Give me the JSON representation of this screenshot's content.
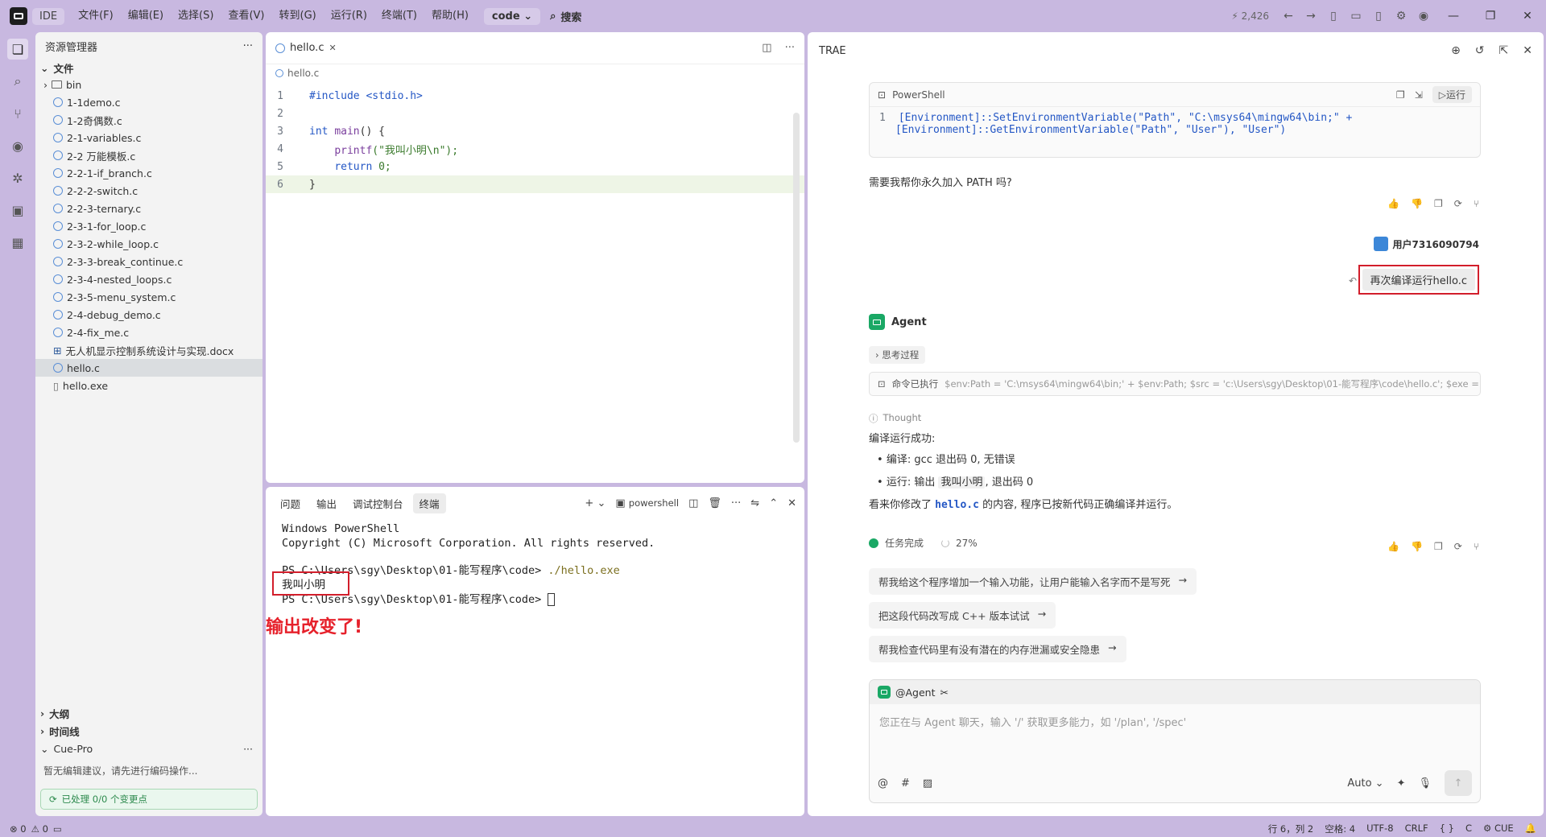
{
  "titlebar": {
    "ide_label": "IDE",
    "menu": [
      "文件(F)",
      "编辑(E)",
      "选择(S)",
      "查看(V)",
      "转到(G)",
      "运行(R)",
      "终端(T)",
      "帮助(H)"
    ],
    "project_dropdown": "code",
    "search_label": "搜索",
    "count": "2,426"
  },
  "explorer": {
    "title": "资源管理器",
    "folder_section": "文件",
    "items": [
      {
        "name": "bin",
        "type": "folder"
      },
      {
        "name": "1-1demo.c",
        "type": "c"
      },
      {
        "name": "1-2奇偶数.c",
        "type": "c"
      },
      {
        "name": "2-1-variables.c",
        "type": "c"
      },
      {
        "name": "2-2 万能模板.c",
        "type": "c"
      },
      {
        "name": "2-2-1-if_branch.c",
        "type": "c"
      },
      {
        "name": "2-2-2-switch.c",
        "type": "c"
      },
      {
        "name": "2-2-3-ternary.c",
        "type": "c"
      },
      {
        "name": "2-3-1-for_loop.c",
        "type": "c"
      },
      {
        "name": "2-3-2-while_loop.c",
        "type": "c"
      },
      {
        "name": "2-3-3-break_continue.c",
        "type": "c"
      },
      {
        "name": "2-3-4-nested_loops.c",
        "type": "c"
      },
      {
        "name": "2-3-5-menu_system.c",
        "type": "c"
      },
      {
        "name": "2-4-debug_demo.c",
        "type": "c"
      },
      {
        "name": "2-4-fix_me.c",
        "type": "c"
      },
      {
        "name": "无人机显示控制系统设计与实现.docx",
        "type": "doc"
      },
      {
        "name": "hello.c",
        "type": "c"
      },
      {
        "name": "hello.exe",
        "type": "exe"
      }
    ],
    "outline": "大纲",
    "timeline": "时间线",
    "cue_pro": "Cue-Pro",
    "cue_text": "暂无编辑建议，请先进行编码操作...",
    "cue_status": "已处理 0/0 个变更点"
  },
  "editor": {
    "tab": "hello.c",
    "breadcrumb": "hello.c",
    "lines": [
      {
        "n": "1",
        "parts": [
          {
            "t": "#include <stdio.h>",
            "c": "kw"
          }
        ]
      },
      {
        "n": "2",
        "parts": []
      },
      {
        "n": "3",
        "parts": [
          {
            "t": "int ",
            "c": "kw"
          },
          {
            "t": "main",
            "c": "fn"
          },
          {
            "t": "() {",
            "c": ""
          }
        ]
      },
      {
        "n": "4",
        "parts": [
          {
            "t": "    ",
            "c": ""
          },
          {
            "t": "printf",
            "c": "fn"
          },
          {
            "t": "(\"我叫小明\\n\");",
            "c": "str"
          }
        ]
      },
      {
        "n": "5",
        "parts": [
          {
            "t": "    ",
            "c": ""
          },
          {
            "t": "return ",
            "c": "kw"
          },
          {
            "t": "0;",
            "c": "str"
          }
        ]
      },
      {
        "n": "6",
        "parts": [
          {
            "t": "}",
            "c": ""
          }
        ]
      }
    ]
  },
  "terminal": {
    "tabs": [
      "问题",
      "输出",
      "调试控制台",
      "终端"
    ],
    "shell": "powershell",
    "lines": [
      {
        "text": "Windows PowerShell",
        "cmd": ""
      },
      {
        "text": "Copyright (C) Microsoft Corporation. All rights reserved.",
        "cmd": ""
      },
      {
        "text": "",
        "cmd": ""
      },
      {
        "text": "PS C:\\Users\\sgy\\Desktop\\01-能写程序\\code> ",
        "cmd": "./hello.exe"
      },
      {
        "text": "我叫小明",
        "cmd": ""
      },
      {
        "text": "PS C:\\Users\\sgy\\Desktop\\01-能写程序\\code> ",
        "cmd": ""
      }
    ],
    "annotation": "输出改变了!"
  },
  "agent": {
    "title": "TRAE",
    "ps_label": "PowerShell",
    "ps_run": "运行",
    "ps_line1": "[Environment]::SetEnvironmentVariable(\"Path\", \"C:\\msys64\\mingw64\\bin;\" +",
    "ps_line2": "[Environment]::GetEnvironmentVariable(\"Path\", \"User\"), \"User\")",
    "question": "需要我帮你永久加入 PATH 吗?",
    "user_name": "用户7316090794",
    "user_msg": "再次编译运行hello.c",
    "agent_name": "Agent",
    "thinking": "思考过程",
    "cmd_label": "命令已执行",
    "cmd_text": "$env:Path = 'C:\\msys64\\mingw64\\bin;' + $env:Path; $src = 'c:\\Users\\sgy\\Desktop\\01-能写程序\\code\\hello.c'; $exe = 'c:\\Us...",
    "thought": "Thought",
    "result_title": "编译运行成功:",
    "bullet1": "编译: gcc 退出码 0, 无错误",
    "bullet2_pre": "运行: 输出 ",
    "bullet2_code": "我叫小明",
    "bullet2_post": ", 退出码 0",
    "summary_pre": "看来你修改了 ",
    "summary_code": "hello.c",
    "summary_post": " 的内容, 程序已按新代码正确编译并运行。",
    "task_done": "任务完成",
    "progress": "27%",
    "suggestions": [
      "帮我给这个程序增加一个输入功能，让用户能输入名字而不是写死",
      "把这段代码改写成 C++ 版本试试",
      "帮我检查代码里有没有潜在的内存泄漏或安全隐患"
    ],
    "input_tag": "@Agent",
    "input_placeholder": "您正在与 Agent 聊天，输入 '/' 获取更多能力，如 '/plan', '/spec'",
    "model": "Auto"
  },
  "status": {
    "errors": "0",
    "warnings": "0",
    "position": "行 6，列 2",
    "spaces": "空格: 4",
    "encoding": "UTF-8",
    "eol": "CRLF",
    "lang": "C",
    "cue": "CUE"
  }
}
